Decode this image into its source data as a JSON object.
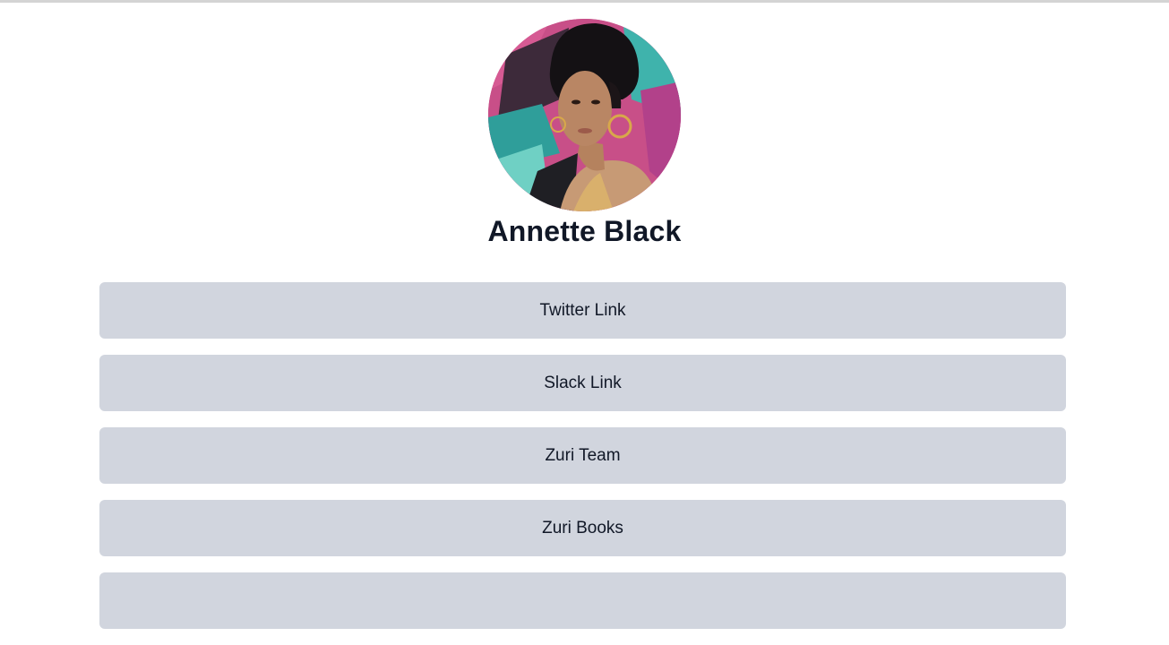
{
  "profile": {
    "name": "Annette Black",
    "avatar_icon": "profile-photo"
  },
  "links": [
    {
      "label": "Twitter Link"
    },
    {
      "label": "Slack Link"
    },
    {
      "label": "Zuri Team"
    },
    {
      "label": "Zuri Books"
    },
    {
      "label": ""
    }
  ],
  "colors": {
    "button_bg": "#d1d5de",
    "text": "#111827",
    "background": "#ffffff"
  }
}
